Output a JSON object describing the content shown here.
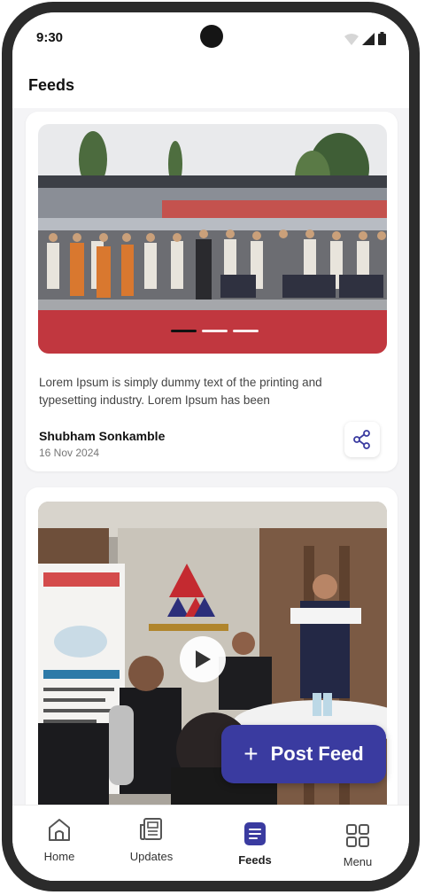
{
  "status": {
    "time": "9:30"
  },
  "header": {
    "title": "Feeds"
  },
  "feeds": [
    {
      "description": "Lorem Ipsum is simply dummy text of the printing and typesetting industry. Lorem Ipsum has been",
      "author": "Shubham Sonkamble",
      "date": "16 Nov 2024",
      "carousel": {
        "count": 3,
        "active": 0
      }
    },
    {
      "type": "video"
    }
  ],
  "fab": {
    "label": "Post Feed",
    "icon": "plus-icon"
  },
  "nav": {
    "items": [
      {
        "label": "Home",
        "icon": "home-icon"
      },
      {
        "label": "Updates",
        "icon": "newspaper-icon"
      },
      {
        "label": "Feeds",
        "icon": "feeds-icon",
        "active": true
      },
      {
        "label": "Menu",
        "icon": "grid-icon"
      }
    ]
  },
  "colors": {
    "accent": "#3a3ba0",
    "red_carpet": "#c1373f"
  }
}
